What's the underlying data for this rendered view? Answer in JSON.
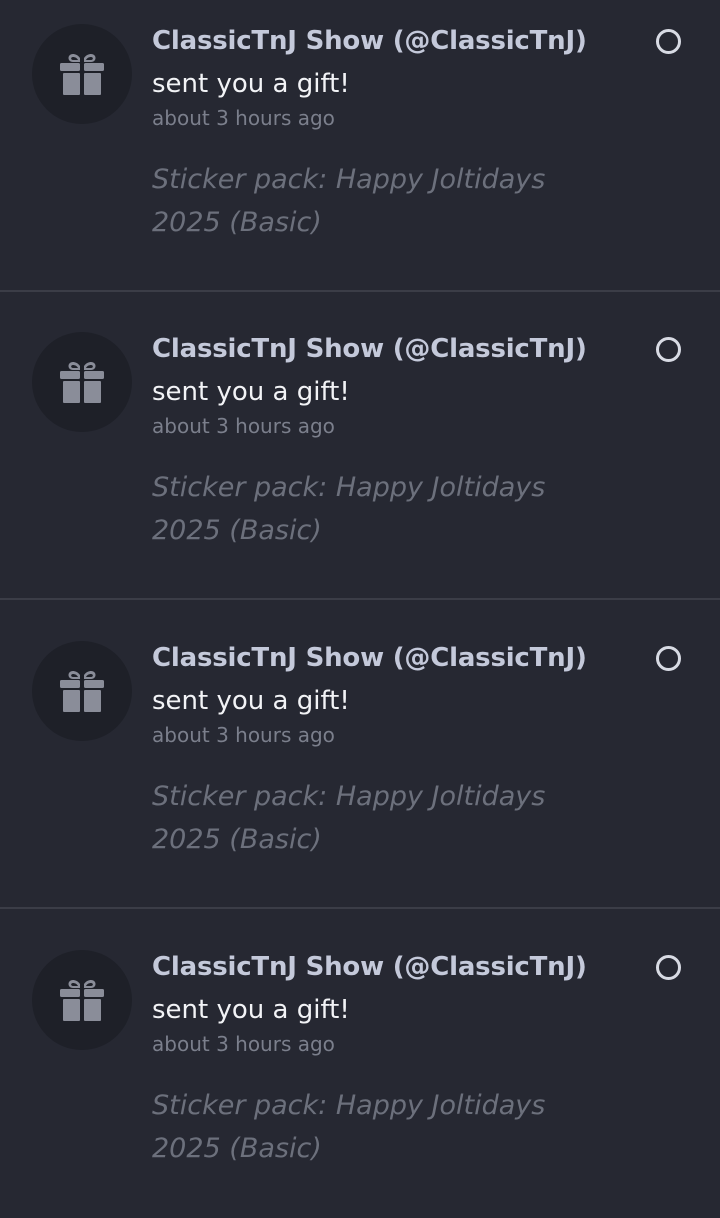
{
  "colors": {
    "background": "#262832",
    "divider": "#3b3d47",
    "avatar_bg": "#1e2028",
    "icon": "#8a8d99",
    "sender": "#c4c9da",
    "action": "#f2f3f6",
    "time": "#7b7f8c",
    "detail": "#6c707c"
  },
  "notifications": [
    {
      "icon": "gift-icon",
      "sender": "ClassicTnJ Show (@ClassicTnJ)",
      "action": "sent you a gift!",
      "time": "about 3 hours ago",
      "detail": "Sticker pack: Happy Joltidays 2025 (Basic)",
      "read_indicator": "circle-outline-icon"
    },
    {
      "icon": "gift-icon",
      "sender": "ClassicTnJ Show (@ClassicTnJ)",
      "action": "sent you a gift!",
      "time": "about 3 hours ago",
      "detail": "Sticker pack: Happy Joltidays 2025 (Basic)",
      "read_indicator": "circle-outline-icon"
    },
    {
      "icon": "gift-icon",
      "sender": "ClassicTnJ Show (@ClassicTnJ)",
      "action": "sent you a gift!",
      "time": "about 3 hours ago",
      "detail": "Sticker pack: Happy Joltidays 2025 (Basic)",
      "read_indicator": "circle-outline-icon"
    },
    {
      "icon": "gift-icon",
      "sender": "ClassicTnJ Show (@ClassicTnJ)",
      "action": "sent you a gift!",
      "time": "about 3 hours ago",
      "detail": "Sticker pack: Happy Joltidays 2025 (Basic)",
      "read_indicator": "circle-outline-icon"
    }
  ]
}
